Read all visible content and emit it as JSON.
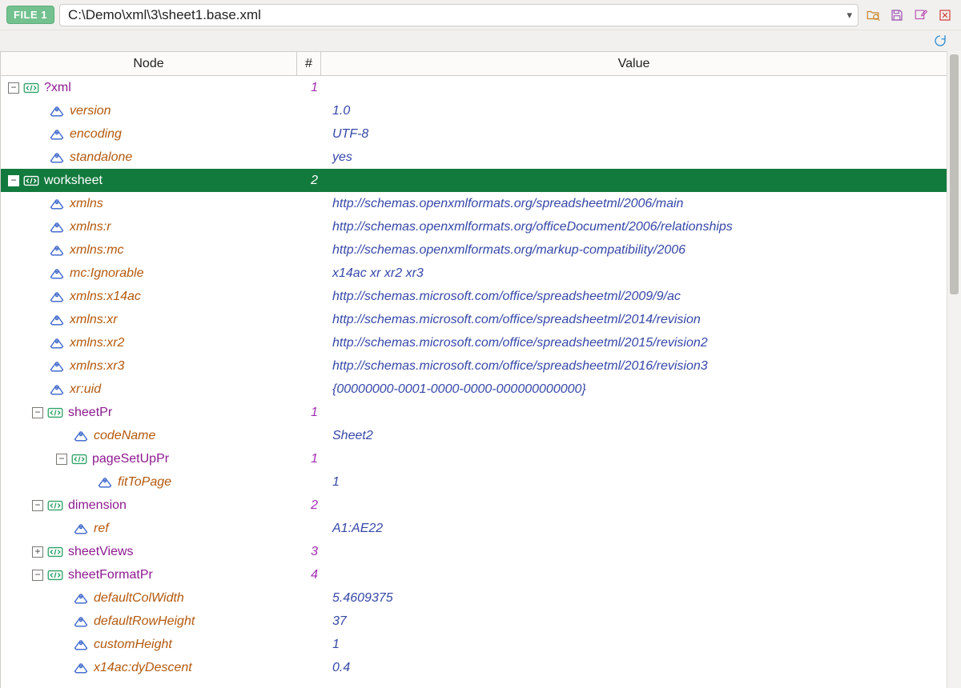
{
  "toolbar": {
    "file_badge": "FILE 1",
    "path": "C:\\Demo\\xml\\3\\sheet1.base.xml"
  },
  "headers": {
    "node": "Node",
    "num": "#",
    "value": "Value"
  },
  "rows": [
    {
      "depth": 0,
      "toggle": "-",
      "kind": "elem",
      "name": "?xml",
      "num": "1",
      "value": "",
      "sel": false
    },
    {
      "depth": 1,
      "toggle": "",
      "kind": "attr",
      "name": "version",
      "num": "",
      "value": "1.0",
      "sel": false
    },
    {
      "depth": 1,
      "toggle": "",
      "kind": "attr",
      "name": "encoding",
      "num": "",
      "value": "UTF-8",
      "sel": false
    },
    {
      "depth": 1,
      "toggle": "",
      "kind": "attr",
      "name": "standalone",
      "num": "",
      "value": "yes",
      "sel": false
    },
    {
      "depth": 0,
      "toggle": "-",
      "kind": "elem",
      "name": "worksheet",
      "num": "2",
      "value": "",
      "sel": true
    },
    {
      "depth": 1,
      "toggle": "",
      "kind": "attr",
      "name": "xmlns",
      "num": "",
      "value": "http://schemas.openxmlformats.org/spreadsheetml/2006/main",
      "sel": false
    },
    {
      "depth": 1,
      "toggle": "",
      "kind": "attr",
      "name": "xmlns:r",
      "num": "",
      "value": "http://schemas.openxmlformats.org/officeDocument/2006/relationships",
      "sel": false
    },
    {
      "depth": 1,
      "toggle": "",
      "kind": "attr",
      "name": "xmlns:mc",
      "num": "",
      "value": "http://schemas.openxmlformats.org/markup-compatibility/2006",
      "sel": false
    },
    {
      "depth": 1,
      "toggle": "",
      "kind": "attr",
      "name": "mc:Ignorable",
      "num": "",
      "value": "x14ac xr xr2 xr3",
      "sel": false
    },
    {
      "depth": 1,
      "toggle": "",
      "kind": "attr",
      "name": "xmlns:x14ac",
      "num": "",
      "value": "http://schemas.microsoft.com/office/spreadsheetml/2009/9/ac",
      "sel": false
    },
    {
      "depth": 1,
      "toggle": "",
      "kind": "attr",
      "name": "xmlns:xr",
      "num": "",
      "value": "http://schemas.microsoft.com/office/spreadsheetml/2014/revision",
      "sel": false
    },
    {
      "depth": 1,
      "toggle": "",
      "kind": "attr",
      "name": "xmlns:xr2",
      "num": "",
      "value": "http://schemas.microsoft.com/office/spreadsheetml/2015/revision2",
      "sel": false
    },
    {
      "depth": 1,
      "toggle": "",
      "kind": "attr",
      "name": "xmlns:xr3",
      "num": "",
      "value": "http://schemas.microsoft.com/office/spreadsheetml/2016/revision3",
      "sel": false
    },
    {
      "depth": 1,
      "toggle": "",
      "kind": "attr",
      "name": "xr:uid",
      "num": "",
      "value": "{00000000-0001-0000-0000-000000000000}",
      "sel": false
    },
    {
      "depth": 1,
      "toggle": "-",
      "kind": "elem",
      "name": "sheetPr",
      "num": "1",
      "value": "",
      "sel": false
    },
    {
      "depth": 2,
      "toggle": "",
      "kind": "attr",
      "name": "codeName",
      "num": "",
      "value": "Sheet2",
      "sel": false
    },
    {
      "depth": 2,
      "toggle": "-",
      "kind": "elem",
      "name": "pageSetUpPr",
      "num": "1",
      "value": "",
      "sel": false
    },
    {
      "depth": 3,
      "toggle": "",
      "kind": "attr",
      "name": "fitToPage",
      "num": "",
      "value": "1",
      "sel": false
    },
    {
      "depth": 1,
      "toggle": "-",
      "kind": "elem",
      "name": "dimension",
      "num": "2",
      "value": "",
      "sel": false
    },
    {
      "depth": 2,
      "toggle": "",
      "kind": "attr",
      "name": "ref",
      "num": "",
      "value": "A1:AE22",
      "sel": false
    },
    {
      "depth": 1,
      "toggle": "+",
      "kind": "elem",
      "name": "sheetViews",
      "num": "3",
      "value": "",
      "sel": false
    },
    {
      "depth": 1,
      "toggle": "-",
      "kind": "elem",
      "name": "sheetFormatPr",
      "num": "4",
      "value": "",
      "sel": false
    },
    {
      "depth": 2,
      "toggle": "",
      "kind": "attr",
      "name": "defaultColWidth",
      "num": "",
      "value": "5.4609375",
      "sel": false
    },
    {
      "depth": 2,
      "toggle": "",
      "kind": "attr",
      "name": "defaultRowHeight",
      "num": "",
      "value": "37",
      "sel": false
    },
    {
      "depth": 2,
      "toggle": "",
      "kind": "attr",
      "name": "customHeight",
      "num": "",
      "value": "1",
      "sel": false
    },
    {
      "depth": 2,
      "toggle": "",
      "kind": "attr",
      "name": "x14ac:dyDescent",
      "num": "",
      "value": "0.4",
      "sel": false
    }
  ]
}
